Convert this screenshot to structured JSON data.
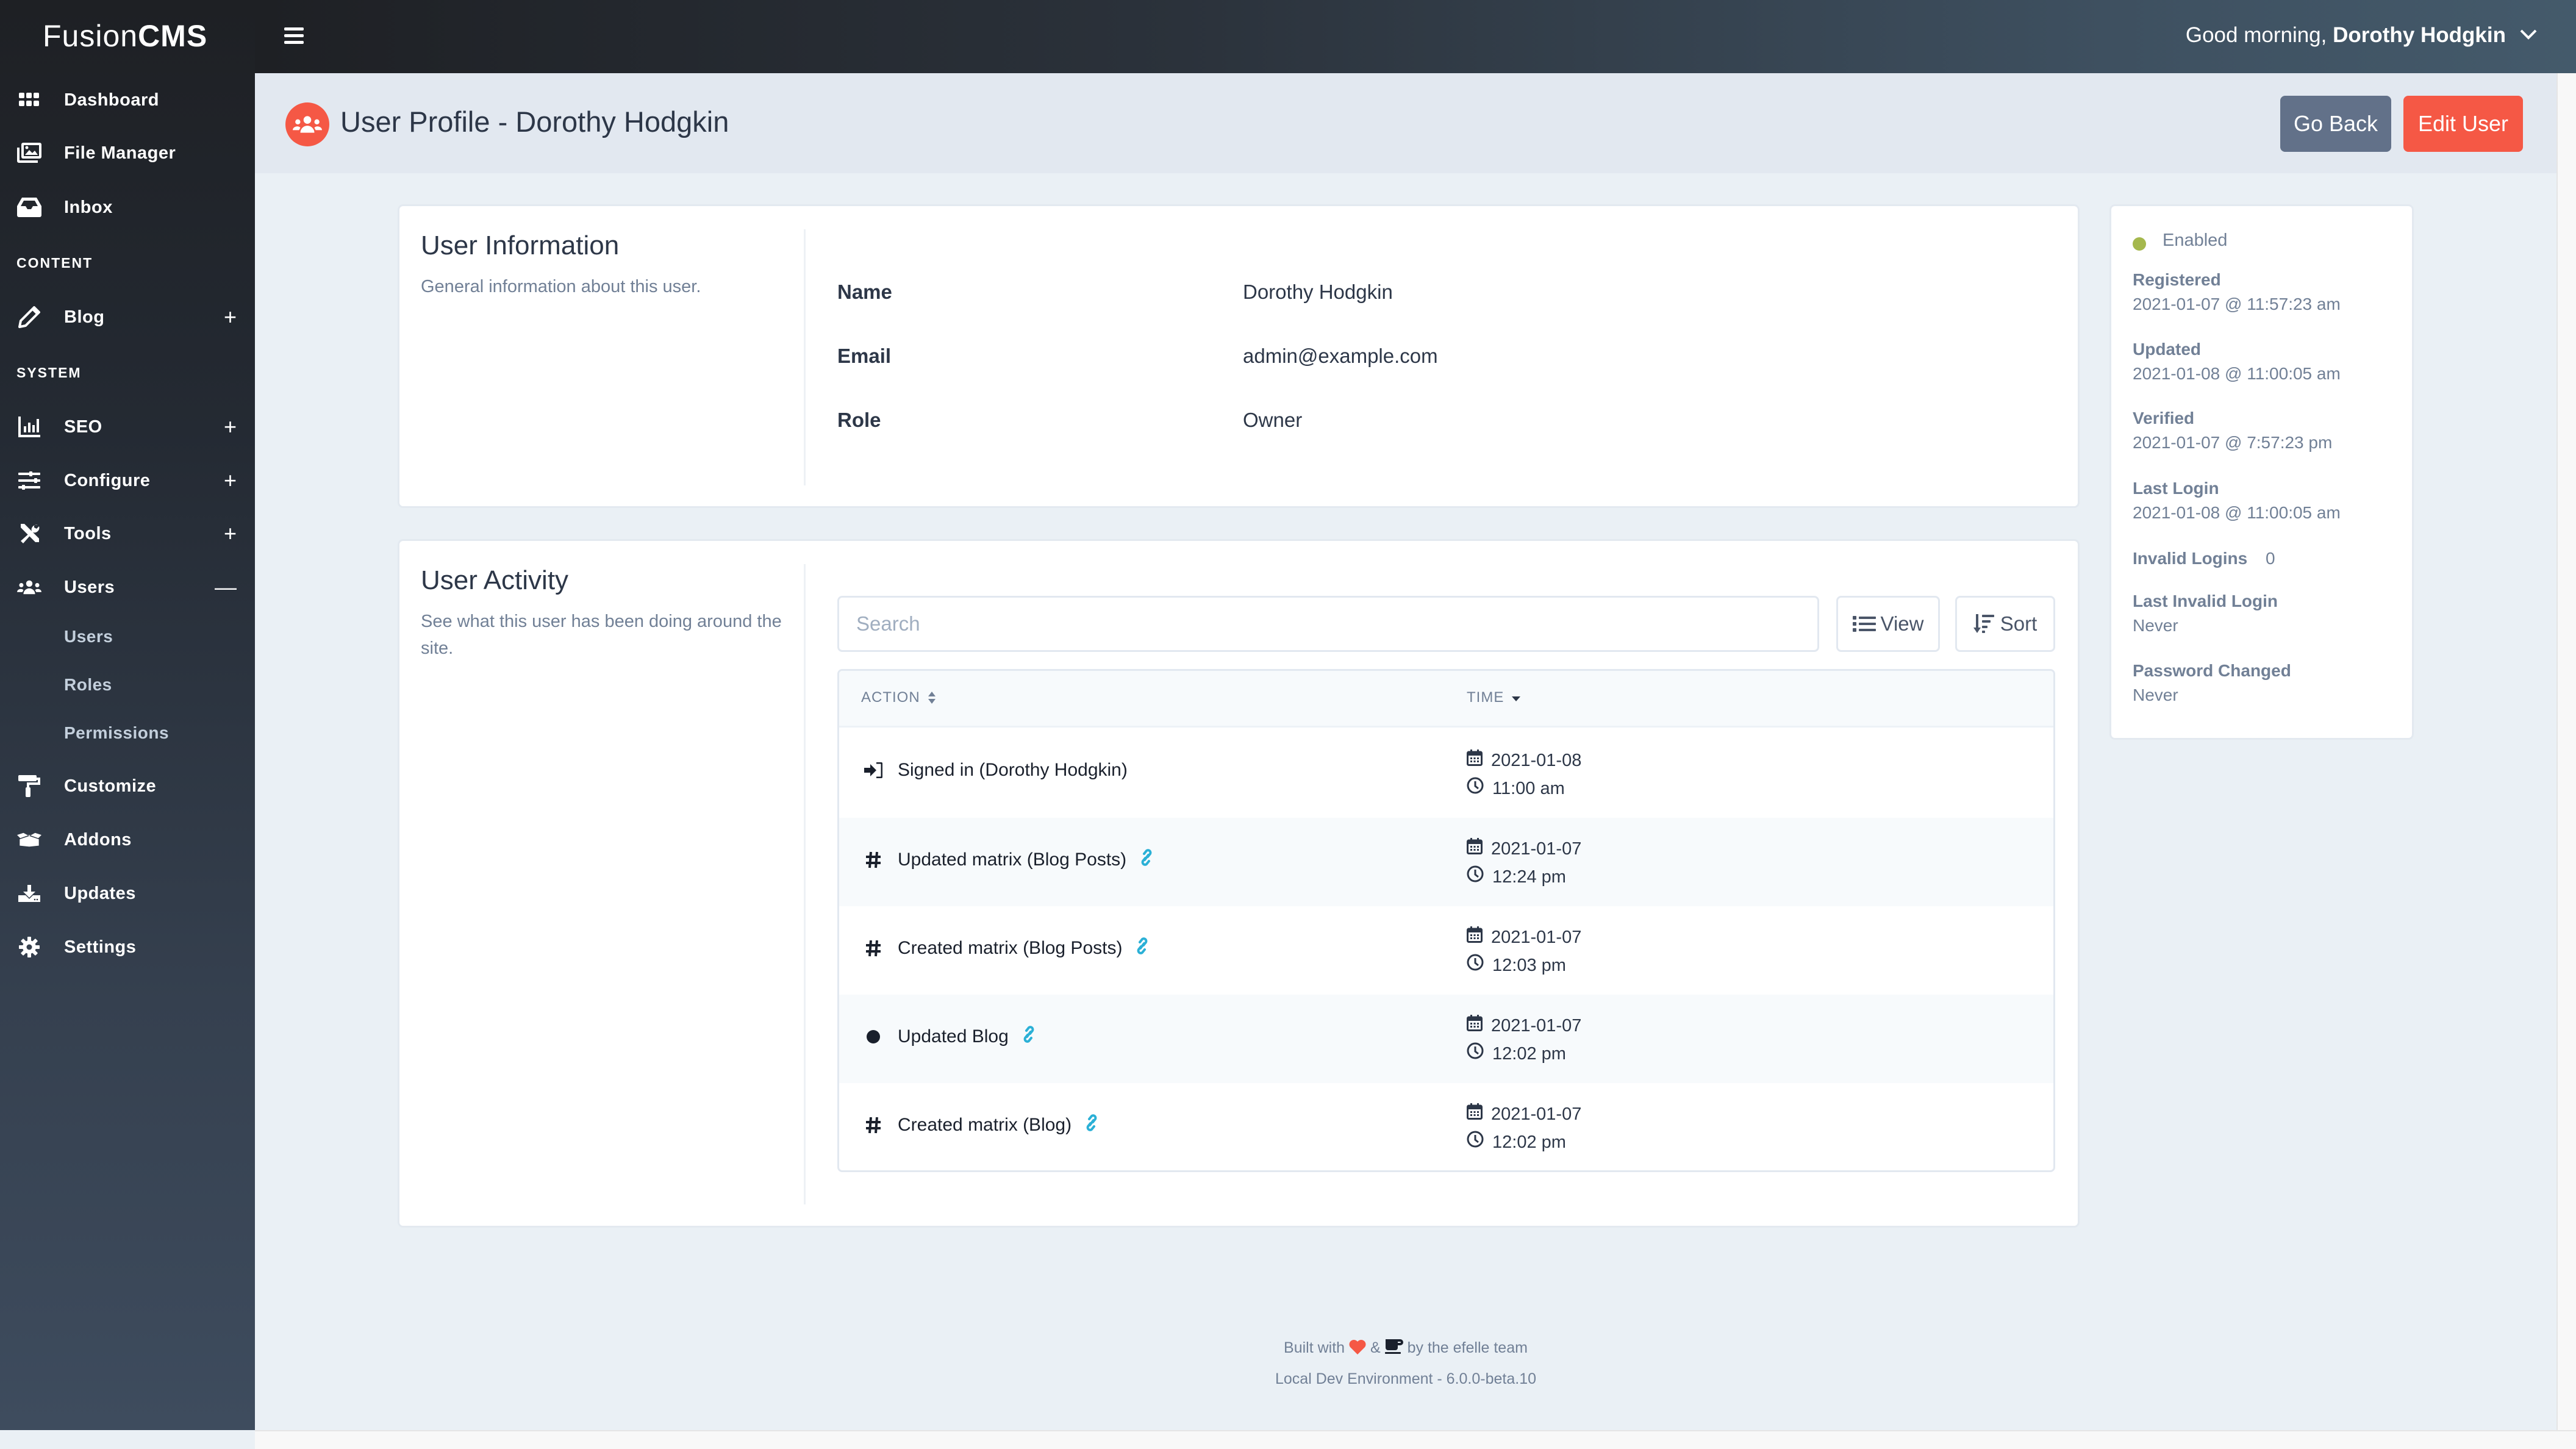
{
  "app": {
    "logo_light": "Fusion",
    "logo_bold": "CMS"
  },
  "topbar": {
    "greeting": "Good morning,",
    "user_name": "Dorothy Hodgkin"
  },
  "sidebar": {
    "items": [
      {
        "label": "Dashboard",
        "icon": "grid-icon"
      },
      {
        "label": "File Manager",
        "icon": "images-icon"
      },
      {
        "label": "Inbox",
        "icon": "inbox-icon"
      }
    ],
    "content_heading": "CONTENT",
    "content_items": [
      {
        "label": "Blog",
        "icon": "pencil-icon",
        "toggle": "+"
      }
    ],
    "system_heading": "SYSTEM",
    "system_items": [
      {
        "label": "SEO",
        "icon": "chart-bar-icon",
        "toggle": "+"
      },
      {
        "label": "Configure",
        "icon": "sliders-icon",
        "toggle": "+"
      },
      {
        "label": "Tools",
        "icon": "tools-icon",
        "toggle": "+"
      },
      {
        "label": "Users",
        "icon": "users-icon",
        "toggle": "—"
      }
    ],
    "users_subitems": [
      "Users",
      "Roles",
      "Permissions"
    ],
    "bottom_items": [
      {
        "label": "Customize",
        "icon": "paint-roller-icon"
      },
      {
        "label": "Addons",
        "icon": "box-open-icon"
      },
      {
        "label": "Updates",
        "icon": "download-icon"
      },
      {
        "label": "Settings",
        "icon": "cog-icon"
      }
    ]
  },
  "header": {
    "title": "User Profile - Dorothy Hodgkin",
    "go_back": "Go Back",
    "edit_user": "Edit User"
  },
  "user_info": {
    "title": "User Information",
    "description": "General information about this user.",
    "fields": [
      {
        "label": "Name",
        "value": "Dorothy Hodgkin"
      },
      {
        "label": "Email",
        "value": "admin@example.com"
      },
      {
        "label": "Role",
        "value": "Owner"
      }
    ]
  },
  "status": {
    "state": "Enabled",
    "state_color": "#a5b84d",
    "registered_label": "Registered",
    "registered": "2021-01-07 @ 11:57:23 am",
    "updated_label": "Updated",
    "updated": "2021-01-08 @ 11:00:05 am",
    "verified_label": "Verified",
    "verified": "2021-01-07 @ 7:57:23 pm",
    "last_login_label": "Last Login",
    "last_login": "2021-01-08 @ 11:00:05 am",
    "invalid_logins_label": "Invalid Logins",
    "invalid_logins": "0",
    "last_invalid_label": "Last Invalid Login",
    "last_invalid": "Never",
    "password_changed_label": "Password Changed",
    "password_changed": "Never"
  },
  "activity": {
    "title": "User Activity",
    "description": "See what this user has been doing around the site.",
    "search_placeholder": "Search",
    "search_value": "",
    "view_label": "View",
    "sort_label": "Sort",
    "columns": [
      "ACTION",
      "TIME"
    ],
    "rows": [
      {
        "icon": "sign-in-icon",
        "action": "Signed in (Dorothy Hodgkin)",
        "has_link": false,
        "date": "2021-01-08",
        "time": "11:00 am"
      },
      {
        "icon": "hashtag-icon",
        "action": "Updated matrix (Blog Posts)",
        "has_link": true,
        "date": "2021-01-07",
        "time": "12:24 pm"
      },
      {
        "icon": "hashtag-icon",
        "action": "Created matrix (Blog Posts)",
        "has_link": true,
        "date": "2021-01-07",
        "time": "12:03 pm"
      },
      {
        "icon": "circle-icon",
        "action": "Updated Blog",
        "has_link": true,
        "date": "2021-01-07",
        "time": "12:02 pm"
      },
      {
        "icon": "hashtag-icon",
        "action": "Created matrix (Blog)",
        "has_link": true,
        "date": "2021-01-07",
        "time": "12:02 pm"
      }
    ]
  },
  "footer": {
    "built_prefix": "Built with",
    "amp": "&",
    "built_suffix": "by the efelle team",
    "environment": "Local Dev Environment - 6.0.0-beta.10"
  },
  "colors": {
    "accent": "#f55845",
    "secondary": "#627189",
    "link": "#2bb0d6"
  }
}
